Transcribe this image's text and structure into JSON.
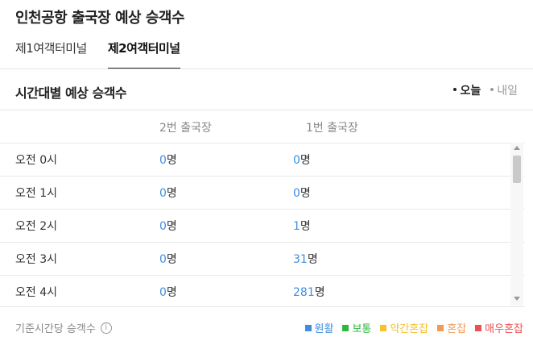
{
  "title": "인천공항 출국장 예상 승객수",
  "tabs": [
    {
      "label": "제1여객터미널",
      "active": false
    },
    {
      "label": "제2여객터미널",
      "active": true
    }
  ],
  "section_title": "시간대별 예상 승객수",
  "day_toggle": {
    "today": "오늘",
    "tomorrow": "내일",
    "selected": "오늘"
  },
  "columns": {
    "gate2": "2번 출국장",
    "gate1": "1번 출국장"
  },
  "rows": [
    {
      "time": "오전 0시",
      "gate2": "0",
      "gate1": "0",
      "unit": "명"
    },
    {
      "time": "오전 1시",
      "gate2": "0",
      "gate1": "0",
      "unit": "명"
    },
    {
      "time": "오전 2시",
      "gate2": "0",
      "gate1": "1",
      "unit": "명"
    },
    {
      "time": "오전 3시",
      "gate2": "0",
      "gate1": "31",
      "unit": "명"
    },
    {
      "time": "오전 4시",
      "gate2": "0",
      "gate1": "281",
      "unit": "명"
    }
  ],
  "footer": {
    "basis_label": "기준시간당 승객수",
    "info_icon": "info-icon"
  },
  "legend": [
    {
      "label": "원활",
      "color": "#3d8ee0"
    },
    {
      "label": "보통",
      "color": "#2db83d"
    },
    {
      "label": "약간혼잡",
      "color": "#f5c12e"
    },
    {
      "label": "혼잡",
      "color": "#f39a57"
    },
    {
      "label": "매우혼잡",
      "color": "#ee4f4f"
    }
  ]
}
